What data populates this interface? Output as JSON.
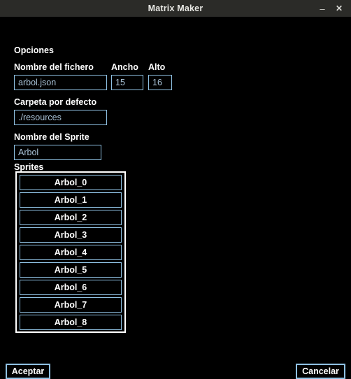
{
  "window": {
    "title": "Matrix Maker",
    "titlebar_buttons": [
      {
        "name": "minimize",
        "glyph": "–"
      },
      {
        "name": "close",
        "glyph": "✕"
      }
    ]
  },
  "options": {
    "section_title": "Opciones",
    "filename": {
      "label": "Nombre del fichero",
      "value": "arbol.json",
      "placeholder": "arbol.json"
    },
    "width": {
      "label": "Ancho",
      "value": "15",
      "placeholder": "15"
    },
    "height": {
      "label": "Alto",
      "value": "16",
      "placeholder": "16"
    },
    "folder": {
      "label": "Carpeta por defecto",
      "value": "./resources",
      "placeholder": "./resources"
    },
    "sprite_name": {
      "label": "Nombre del Sprite",
      "value": "Arbol",
      "placeholder": "Arbol"
    }
  },
  "sprites": {
    "label": "Sprites",
    "items": [
      {
        "label": "Arbol_0"
      },
      {
        "label": "Arbol_1"
      },
      {
        "label": "Arbol_2"
      },
      {
        "label": "Arbol_3"
      },
      {
        "label": "Arbol_4"
      },
      {
        "label": "Arbol_5"
      },
      {
        "label": "Arbol_6"
      },
      {
        "label": "Arbol_7"
      },
      {
        "label": "Arbol_8"
      }
    ]
  },
  "footer": {
    "accept_label": "Aceptar",
    "cancel_label": "Cancelar"
  },
  "colors": {
    "accent_border": "#8fc1e3",
    "titlebar_bg": "#2b2b28",
    "background": "#000000",
    "field_text": "#a9c2d6",
    "frame_border": "#ffffff"
  }
}
